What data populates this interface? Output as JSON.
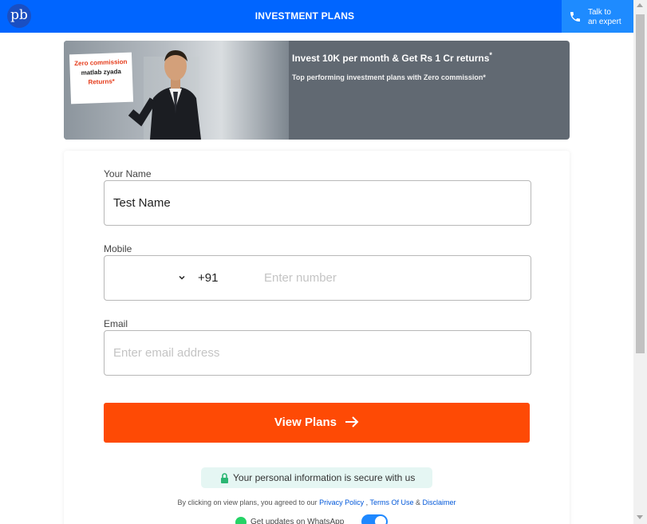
{
  "header": {
    "logo_text": "pb",
    "title": "INVESTMENT PLANS",
    "expert_line1": "Talk to",
    "expert_line2": "an expert"
  },
  "banner": {
    "placard_line1": "Zero commission",
    "placard_line2": "matlab zyada",
    "placard_line3": "Returns*",
    "headline": "Invest 10K per month & Get Rs 1 Cr returns",
    "headline_mark": "*",
    "subline": "Top performing investment plans with Zero commission*"
  },
  "form": {
    "name_label": "Your Name",
    "name_value": "Test Name",
    "mobile_label": "Mobile",
    "country_code": "+91",
    "mobile_placeholder": "Enter number",
    "email_label": "Email",
    "email_placeholder": "Enter email address",
    "submit_label": "View Plans"
  },
  "footer": {
    "secure_text": "Your personal information is secure with us",
    "terms_prefix": "By clicking on view plans, you agreed to our",
    "privacy_link": "Privacy Policy",
    "sep1": ",",
    "terms_link": "Terms Of Use",
    "sep2": "&",
    "disclaimer_link": "Disclaimer",
    "whatsapp_text": "Get updates on WhatsApp",
    "whatsapp_enabled": true
  },
  "colors": {
    "header_bg": "#0065ff",
    "cta_bg": "#fe4a05",
    "link": "#0057d9",
    "secure_bg": "#e5f6f3"
  },
  "icons": {
    "logo": "pb-logo-icon",
    "phone": "phone-icon",
    "chevron": "chevron-down-icon",
    "arrow": "arrow-right-icon",
    "lock": "lock-icon",
    "whatsapp": "whatsapp-icon"
  }
}
